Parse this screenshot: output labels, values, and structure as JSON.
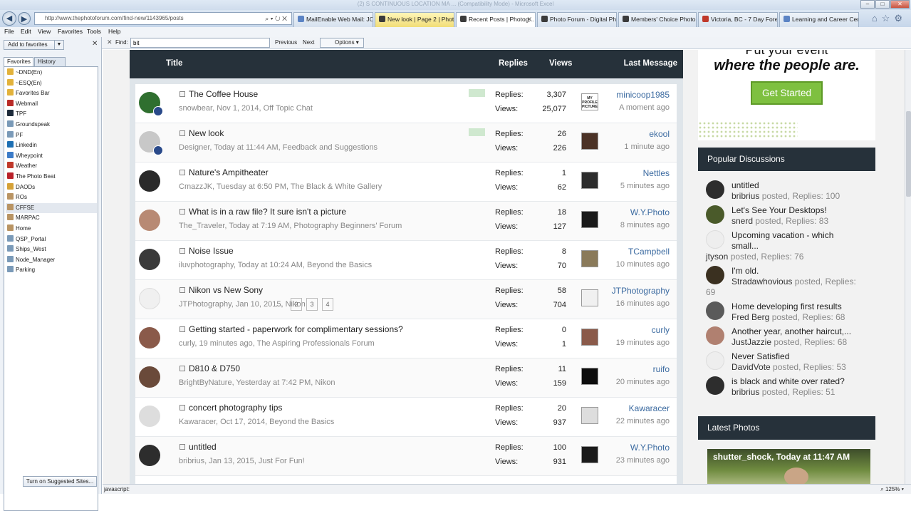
{
  "window": {
    "title": "(2) S CONTINUOUS LOCATION MA ... (Compatibility Mode) - Microsoft Excel"
  },
  "browser": {
    "address": "http://www.thephotoforum.com/find-new/1143965/posts",
    "tabs": [
      {
        "label": "MailEnable Web Mail: JO...",
        "color": "#5b83c4"
      },
      {
        "label": "New look | Page 2 | Phot...",
        "color": "#3b3b3b"
      },
      {
        "label": "Recent Posts | Photog...",
        "color": "#3b3b3b"
      },
      {
        "label": "Photo Forum - Digital Ph...",
        "color": "#3b3b3b"
      },
      {
        "label": "Members' Choice Photo ...",
        "color": "#3b3b3b"
      },
      {
        "label": "Victoria, BC - 7 Day Forec...",
        "color": "#c0392b"
      },
      {
        "label": "Learning and Career Cen...",
        "color": "#5b83c4"
      }
    ],
    "menu": [
      "File",
      "Edit",
      "View",
      "Favorites",
      "Tools",
      "Help"
    ],
    "find": {
      "label": "Find:",
      "value": "bit",
      "prev": "Previous",
      "next": "Next",
      "options": "Options"
    }
  },
  "favorites": {
    "add_label": "Add to favorites",
    "tab_favorites": "Favorites",
    "tab_history": "History",
    "suggest_label": "Turn on Suggested Sites...",
    "items": [
      {
        "label": "~DND(En)",
        "color": "#e2b23b"
      },
      {
        "label": "~ESQ(En)",
        "color": "#e2b23b"
      },
      {
        "label": "Favorites Bar",
        "color": "#e2b23b"
      },
      {
        "label": "Webmail",
        "color": "#b92b27"
      },
      {
        "label": "TPF",
        "color": "#1d2a3a"
      },
      {
        "label": "Groundspeak",
        "color": "#7a9ab8"
      },
      {
        "label": "PF",
        "color": "#7a9ab8"
      },
      {
        "label": "Linkedin",
        "color": "#1d6fb3"
      },
      {
        "label": "Wheypoint",
        "color": "#3b7bc8"
      },
      {
        "label": "Weather",
        "color": "#c0392b"
      },
      {
        "label": "The Photo Beat",
        "color": "#b9212a"
      },
      {
        "label": "DAODs",
        "color": "#d5a137"
      },
      {
        "label": "ROs",
        "color": "#b99463"
      },
      {
        "label": "CFFSE",
        "color": "#b99463"
      },
      {
        "label": "MARPAC",
        "color": "#b99463"
      },
      {
        "label": "Home",
        "color": "#b99463"
      },
      {
        "label": "QSP_Portal",
        "color": "#7a9ab8"
      },
      {
        "label": "Ships_West",
        "color": "#7a9ab8"
      },
      {
        "label": "Node_Manager",
        "color": "#7a9ab8"
      },
      {
        "label": "Parking",
        "color": "#7a9ab8"
      }
    ]
  },
  "thread_list": {
    "headers": {
      "title": "Title",
      "replies": "Replies",
      "views": "Views",
      "last": "Last Message"
    },
    "replies_label": "Replies:",
    "views_label": "Views:",
    "rows": [
      {
        "title": "The Coffee House",
        "meta": "snowbear, Nov 1, 2014, Off Topic Chat",
        "replies": "3,307",
        "views": "25,077",
        "last_user": "minicoop1985",
        "last_time": "A moment ago",
        "avatar": "#2f6f2f",
        "lp": "#ffffff",
        "lp_text": "MY PROFILE PICTURE",
        "new": true,
        "second_av": true
      },
      {
        "title": "New look",
        "meta": "Designer, Today at 11:44 AM, Feedback and Suggestions",
        "replies": "26",
        "views": "226",
        "last_user": "ekool",
        "last_time": "1 minute ago",
        "avatar": "#c8c8c8",
        "lp": "#4b3226",
        "new": true,
        "second_av": true
      },
      {
        "title": "Nature's Ampitheater",
        "meta": "CmazzJK, Tuesday at 6:50 PM, The Black & White Gallery",
        "replies": "1",
        "views": "62",
        "last_user": "Nettles",
        "last_time": "5 minutes ago",
        "avatar": "#2a2a2a",
        "lp": "#2c2c2c"
      },
      {
        "title": "What is in a raw file? It sure isn't a picture",
        "meta": "The_Traveler, Today at 7:19 AM, Photography Beginners' Forum",
        "replies": "18",
        "views": "127",
        "last_user": "W.Y.Photo",
        "last_time": "8 minutes ago",
        "avatar": "#b88a74",
        "lp": "#1a1a1a"
      },
      {
        "title": "Noise Issue",
        "meta": "iluvphotography, Today at 10:24 AM, Beyond the Basics",
        "replies": "8",
        "views": "70",
        "last_user": "TCampbell",
        "last_time": "10 minutes ago",
        "avatar": "#3a3a3a",
        "lp": "#8a7a5a"
      },
      {
        "title": "Nikon vs New Sony",
        "meta": "JTPhotography, Jan 10, 2015, Nikon",
        "replies": "58",
        "views": "704",
        "last_user": "JTPhotography",
        "last_time": "16 minutes ago",
        "avatar": "#f0f0f0",
        "lp": "#f0f0f0",
        "pages": [
          "2",
          "3",
          "4"
        ],
        "ellipsis": "..."
      },
      {
        "title": "Getting started - paperwork for complimentary sessions?",
        "meta": "curly, 19 minutes ago, The Aspiring Professionals Forum",
        "replies": "0",
        "views": "1",
        "last_user": "curly",
        "last_time": "19 minutes ago",
        "avatar": "#8a5a4a",
        "lp": "#8a5a4a"
      },
      {
        "title": "D810 & D750",
        "meta": "BrightByNature, Yesterday at 7:42 PM, Nikon",
        "replies": "11",
        "views": "159",
        "last_user": "ruifo",
        "last_time": "20 minutes ago",
        "avatar": "#6a4a3a",
        "lp": "#0d0d0d"
      },
      {
        "title": "concert photography tips",
        "meta": "Kawaracer, Oct 17, 2014, Beyond the Basics",
        "replies": "20",
        "views": "937",
        "last_user": "Kawaracer",
        "last_time": "22 minutes ago",
        "avatar": "#dddddd",
        "lp": "#dddddd"
      },
      {
        "title": "untitled",
        "meta": "bribrius, Jan 13, 2015, Just For Fun!",
        "replies": "100",
        "views": "931",
        "last_user": "W.Y.Photo",
        "last_time": "23 minutes ago",
        "avatar": "#2d2d2d",
        "lp": "#1a1a1a"
      }
    ]
  },
  "ad": {
    "line1": "Put your event",
    "line2": "where the people are.",
    "button": "Get Started"
  },
  "popular": {
    "title": "Popular Discussions",
    "posted_word": "posted,",
    "items": [
      {
        "title": "untitled",
        "user": "bribrius",
        "replies": "Replies: 100",
        "avatar": "#2d2d2d"
      },
      {
        "title": "Let's See Your Desktops!",
        "user": "snerd",
        "replies": "Replies: 83",
        "avatar": "#4a5a2a"
      },
      {
        "title": "Upcoming vacation - which",
        "title2": "small...",
        "user": "jtyson",
        "replies": "Replies: 76",
        "avatar": "#eeeeee"
      },
      {
        "title": "I'm old.",
        "user": "Stradawhovious",
        "replies": "Replies:",
        "replies2": "69",
        "avatar": "#3a3020"
      },
      {
        "title": "Home developing first results",
        "user": "Fred Berg",
        "replies": "Replies: 68",
        "avatar": "#5a5a5a"
      },
      {
        "title": "Another year, another haircut,...",
        "user": "JustJazzie",
        "replies": "Replies: 68",
        "avatar": "#b08070"
      },
      {
        "title": "Never Satisfied",
        "user": "DavidVote",
        "replies": "Replies: 53",
        "avatar": "#eeeeee"
      },
      {
        "title": "is black and white over rated?",
        "user": "bribrius",
        "replies": "Replies: 51",
        "avatar": "#2d2d2d"
      }
    ]
  },
  "latest": {
    "title": "Latest Photos",
    "caption": "shutter_shock, Today at 11:47 AM"
  },
  "status": {
    "text": "javascript:",
    "zoom": "125%"
  }
}
